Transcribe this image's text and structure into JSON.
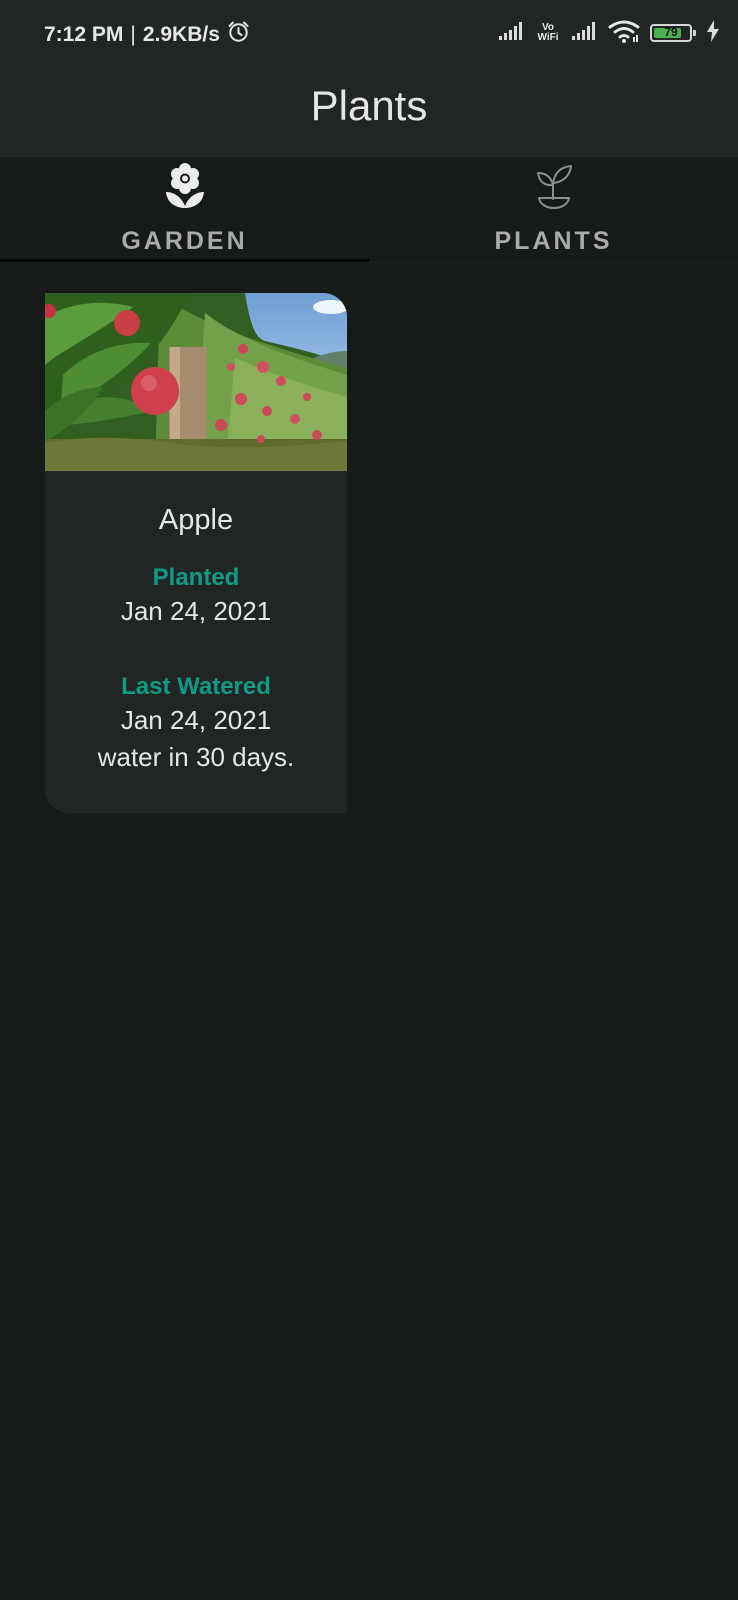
{
  "status_bar": {
    "time": "7:12 PM",
    "speed": "2.9KB/s",
    "vowifi_top": "Vo",
    "vowifi_bottom": "WiFi",
    "battery_level": "79",
    "battery_color": "#4caf50",
    "icons": [
      "alarm-icon",
      "signal-icon",
      "vowifi-icon",
      "signal-icon",
      "wifi-icon",
      "battery-icon",
      "charging-icon"
    ]
  },
  "app_bar": {
    "title": "Plants"
  },
  "tabs": [
    {
      "label": "GARDEN",
      "icon": "flower-icon",
      "selected": true
    },
    {
      "label": "PLANTS",
      "icon": "sprout-icon",
      "selected": false
    }
  ],
  "garden": {
    "cards": [
      {
        "name": "Apple",
        "image_description": "apple-tree-photo",
        "planted_label": "Planted",
        "planted_date": "Jan 24, 2021",
        "watered_label": "Last Watered",
        "watered_date": "Jan 24, 2021",
        "water_schedule": "water in 30 days."
      }
    ]
  },
  "colors": {
    "accent": "#0f9b86",
    "background": "#161a18",
    "surface": "#212624"
  }
}
